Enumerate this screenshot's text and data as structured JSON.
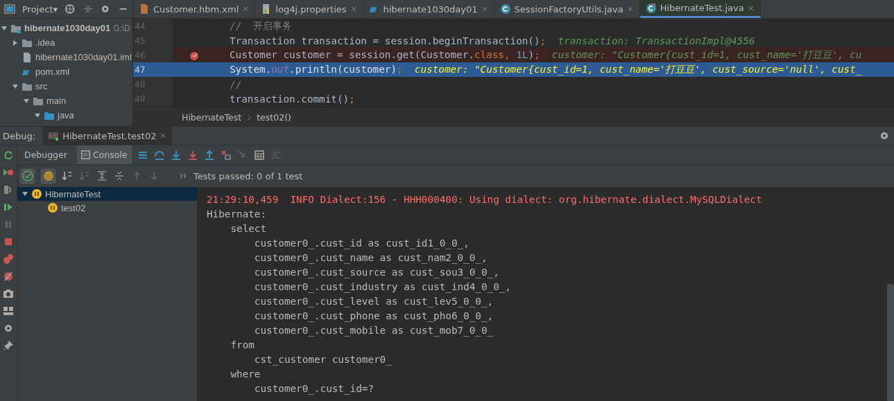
{
  "project_panel": {
    "title": "Project▾",
    "tree": [
      {
        "label": "hibernate1030day01",
        "hint": "G:\\D",
        "kind": "module",
        "expanded": true,
        "children": [
          {
            "label": ".idea",
            "kind": "folder",
            "expanded": false
          },
          {
            "label": "hibernate1030day01.iml",
            "kind": "file"
          },
          {
            "label": "pom.xml",
            "kind": "maven"
          },
          {
            "label": "src",
            "kind": "folder",
            "expanded": true,
            "children": [
              {
                "label": "main",
                "kind": "folder",
                "expanded": true,
                "children": [
                  {
                    "label": "java",
                    "kind": "source",
                    "expanded": true
                  }
                ]
              }
            ]
          }
        ]
      }
    ]
  },
  "editor_tabs": [
    {
      "label": "Customer.hbm.xml",
      "kind": "xml",
      "selected": false
    },
    {
      "label": "log4j.properties",
      "kind": "props",
      "selected": false
    },
    {
      "label": "hibernate1030day01",
      "kind": "maven",
      "selected": false
    },
    {
      "label": "SessionFactoryUtils.java",
      "kind": "class",
      "selected": false
    },
    {
      "label": "HibernateTest.java",
      "kind": "test",
      "selected": true
    }
  ],
  "code_lines": [
    {
      "number": "44",
      "kind": "normal",
      "segments": [
        {
          "kind": "comment",
          "text": "//  开启事务"
        }
      ]
    },
    {
      "number": "45",
      "kind": "normal",
      "segments": [
        {
          "kind": "plain",
          "text": "Transaction transaction = session.beginTransaction()"
        },
        {
          "kind": "punct",
          "text": ";"
        },
        {
          "kind": "hint",
          "text": "  transaction: TransactionImpl@4556"
        }
      ]
    },
    {
      "number": "46",
      "kind": "breakpoint",
      "segments": [
        {
          "kind": "plain",
          "text": "Customer customer = session.get(Customer."
        },
        {
          "kind": "keyword",
          "text": "class"
        },
        {
          "kind": "punct",
          "text": ", "
        },
        {
          "kind": "number",
          "text": "1L"
        },
        {
          "kind": "plain",
          "text": ")"
        },
        {
          "kind": "punct",
          "text": ";"
        },
        {
          "kind": "hint",
          "text": "  customer: \"Customer{cust_id=1, cust_name='打豆豆', cu"
        }
      ]
    },
    {
      "number": "47",
      "kind": "current",
      "segments": [
        {
          "kind": "plain",
          "text": "System."
        },
        {
          "kind": "field",
          "text": "out"
        },
        {
          "kind": "plain",
          "text": ".println(customer)"
        },
        {
          "kind": "punct",
          "text": ";"
        },
        {
          "kind": "hint",
          "text": "  customer: \"Customer{cust_id=1, cust_name='打豆豆', cust_source='null', cust_"
        }
      ]
    },
    {
      "number": "48",
      "kind": "normal",
      "segments": [
        {
          "kind": "comment",
          "text": "//"
        }
      ]
    },
    {
      "number": "49",
      "kind": "normal",
      "segments": [
        {
          "kind": "plain",
          "text": "transaction.commit()"
        },
        {
          "kind": "punct",
          "text": ";"
        }
      ]
    }
  ],
  "breadcrumb": [
    "HibernateTest",
    "test02()"
  ],
  "debug": {
    "label": "Debug:",
    "session_tab": "HibernateTest.test02",
    "tabs": [
      {
        "label": "Debugger",
        "selected": false
      },
      {
        "label": "Console",
        "selected": true
      }
    ],
    "status": "Tests passed: 0 of 1 test",
    "tests": [
      {
        "label": "HibernateTest",
        "selected": true,
        "children": [
          {
            "label": "test02",
            "selected": false
          }
        ]
      }
    ],
    "console": [
      {
        "kind": "error",
        "text": "21:29:10,459  INFO Dialect:156 - HHH000400: Using dialect: org.hibernate.dialect.MySQLDialect"
      },
      {
        "kind": "plain",
        "text": "Hibernate: "
      },
      {
        "kind": "plain",
        "text": "    select"
      },
      {
        "kind": "plain",
        "text": "        customer0_.cust_id as cust_id1_0_0_,"
      },
      {
        "kind": "plain",
        "text": "        customer0_.cust_name as cust_nam2_0_0_,"
      },
      {
        "kind": "plain",
        "text": "        customer0_.cust_source as cust_sou3_0_0_,"
      },
      {
        "kind": "plain",
        "text": "        customer0_.cust_industry as cust_ind4_0_0_,"
      },
      {
        "kind": "plain",
        "text": "        customer0_.cust_level as cust_lev5_0_0_,"
      },
      {
        "kind": "plain",
        "text": "        customer0_.cust_phone as cust_pho6_0_0_,"
      },
      {
        "kind": "plain",
        "text": "        customer0_.cust_mobile as cust_mob7_0_0_ "
      },
      {
        "kind": "plain",
        "text": "    from"
      },
      {
        "kind": "plain",
        "text": "        cst_customer customer0_ "
      },
      {
        "kind": "plain",
        "text": "    where"
      },
      {
        "kind": "plain",
        "text": "        customer0_.cust_id=?"
      }
    ]
  }
}
